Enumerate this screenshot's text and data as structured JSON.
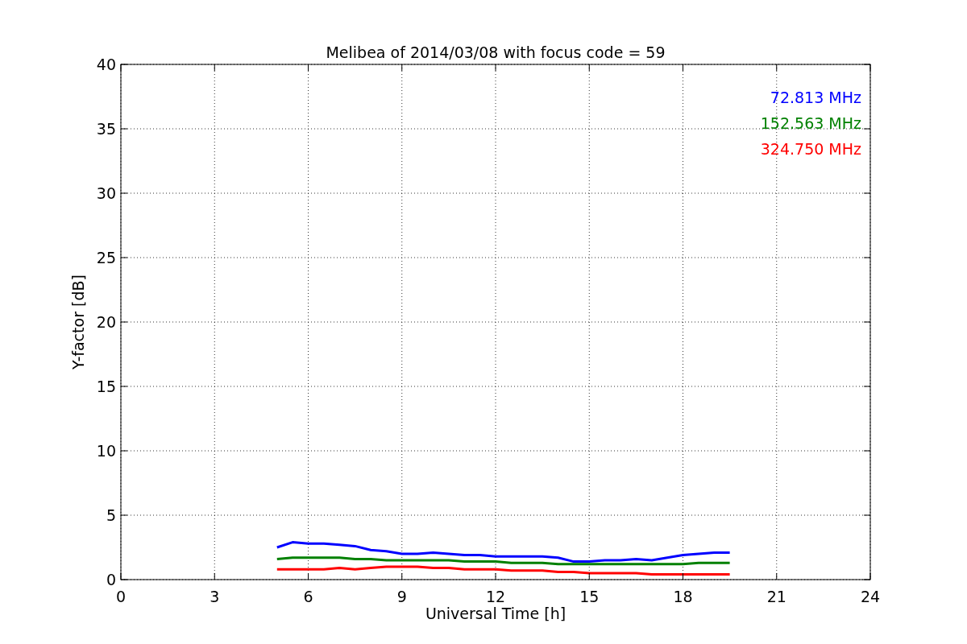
{
  "chart_data": {
    "type": "line",
    "title": "Melibea of 2014/03/08 with focus code = 59",
    "xlabel": "Universal Time [h]",
    "ylabel": "Y-factor [dB]",
    "x": [
      5,
      5.5,
      6,
      6.5,
      7,
      7.5,
      8,
      8.5,
      9,
      9.5,
      10,
      10.5,
      11,
      11.5,
      12,
      12.5,
      13,
      13.5,
      14,
      14.5,
      15,
      15.5,
      16,
      16.5,
      17,
      17.5,
      18,
      18.5,
      19,
      19.5
    ],
    "series": [
      {
        "name": "72.813 MHz",
        "color": "#0000ff",
        "values": [
          2.5,
          2.9,
          2.8,
          2.8,
          2.7,
          2.6,
          2.3,
          2.2,
          2.0,
          2.0,
          2.1,
          2.0,
          1.9,
          1.9,
          1.8,
          1.8,
          1.8,
          1.8,
          1.7,
          1.4,
          1.4,
          1.5,
          1.5,
          1.6,
          1.5,
          1.7,
          1.9,
          2.0,
          2.1,
          2.1
        ]
      },
      {
        "name": "152.563 MHz",
        "color": "#008000",
        "values": [
          1.6,
          1.7,
          1.7,
          1.7,
          1.7,
          1.6,
          1.6,
          1.5,
          1.5,
          1.5,
          1.5,
          1.5,
          1.4,
          1.4,
          1.4,
          1.3,
          1.3,
          1.3,
          1.2,
          1.2,
          1.2,
          1.2,
          1.2,
          1.2,
          1.2,
          1.2,
          1.2,
          1.3,
          1.3,
          1.3
        ]
      },
      {
        "name": "324.750 MHz",
        "color": "#ff0000",
        "values": [
          0.8,
          0.8,
          0.8,
          0.8,
          0.9,
          0.8,
          0.9,
          1.0,
          1.0,
          1.0,
          0.9,
          0.9,
          0.8,
          0.8,
          0.8,
          0.7,
          0.7,
          0.7,
          0.6,
          0.6,
          0.5,
          0.5,
          0.5,
          0.5,
          0.4,
          0.4,
          0.4,
          0.4,
          0.4,
          0.4
        ]
      }
    ],
    "grid": true,
    "xlim": [
      0,
      24
    ],
    "ylim": [
      0,
      40
    ],
    "xticks": [
      0,
      3,
      6,
      9,
      12,
      15,
      18,
      21,
      24
    ],
    "yticks": [
      0,
      5,
      10,
      15,
      20,
      25,
      30,
      35,
      40
    ]
  }
}
